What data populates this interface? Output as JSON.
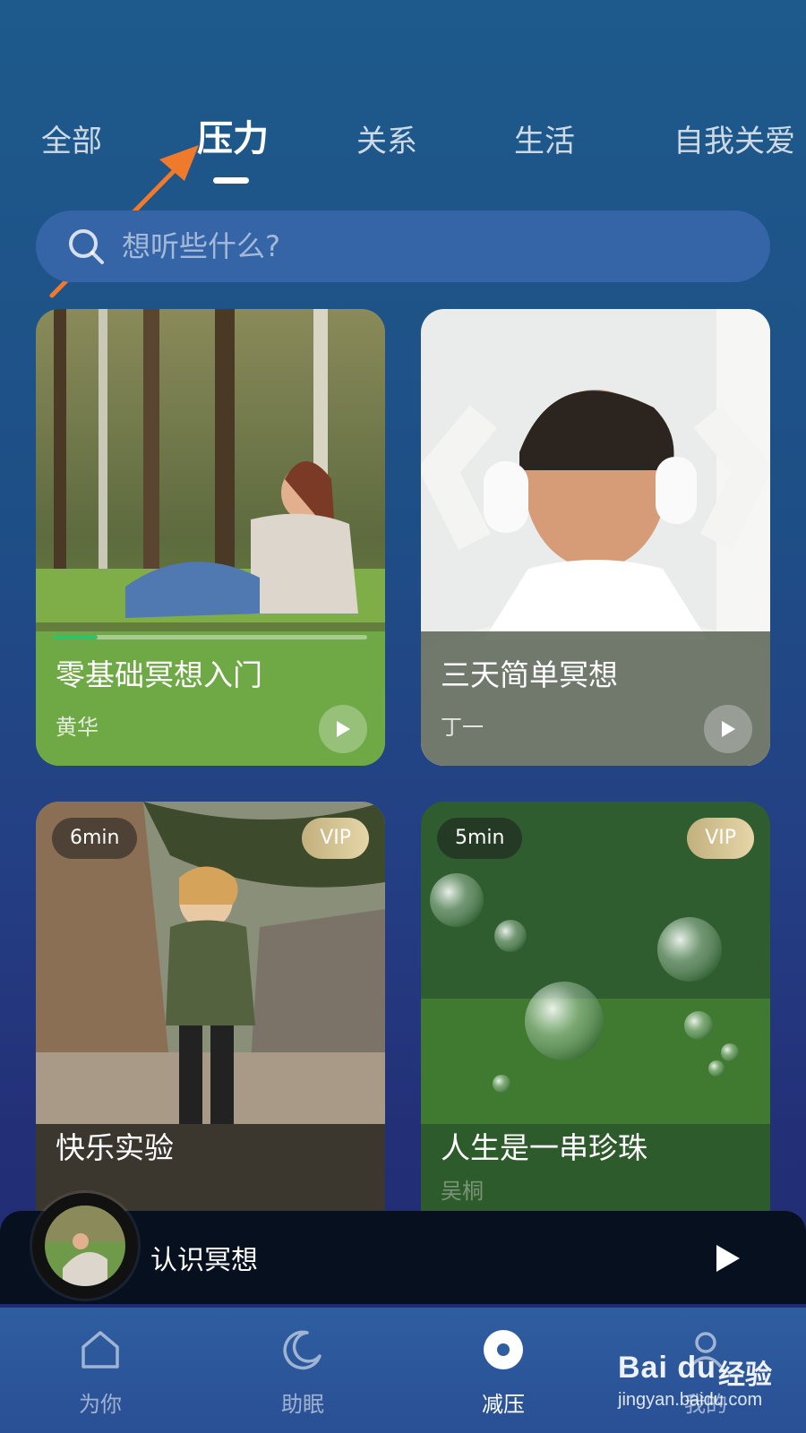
{
  "tabs": [
    {
      "label": "全部",
      "active": false
    },
    {
      "label": "压力",
      "active": true
    },
    {
      "label": "关系",
      "active": false
    },
    {
      "label": "生活",
      "active": false
    },
    {
      "label": "自我关爱",
      "active": false
    }
  ],
  "search": {
    "placeholder": "想听些什么?"
  },
  "cards": [
    {
      "title": "零基础冥想入门",
      "author": "黄华",
      "progress": 0.14,
      "duration": "",
      "vip": false
    },
    {
      "title": "三天简单冥想",
      "author": "丁一",
      "duration": "",
      "vip": false
    },
    {
      "title": "快乐实验",
      "author": "",
      "duration": "6min",
      "vip": true,
      "vip_label": "VIP"
    },
    {
      "title": "人生是一串珍珠",
      "author": "吴桐",
      "duration": "5min",
      "vip": true,
      "vip_label": "VIP"
    }
  ],
  "mini_player": {
    "title": "认识冥想",
    "state": "paused"
  },
  "bottom_nav": [
    {
      "label": "为你",
      "icon": "home-icon",
      "active": false
    },
    {
      "label": "助眠",
      "icon": "moon-icon",
      "active": false
    },
    {
      "label": "减压",
      "icon": "target-icon",
      "active": true
    },
    {
      "label": "我的",
      "icon": "profile-icon",
      "active": false
    }
  ],
  "watermark": {
    "logo": "Bai  du",
    "text": "经验",
    "url": "jingyan.baidu.com"
  },
  "colors": {
    "progress": "#2ec26a",
    "vip": "#d8c693",
    "arrow": "#f07a2c",
    "nav_bg": "#2e5ea0"
  }
}
